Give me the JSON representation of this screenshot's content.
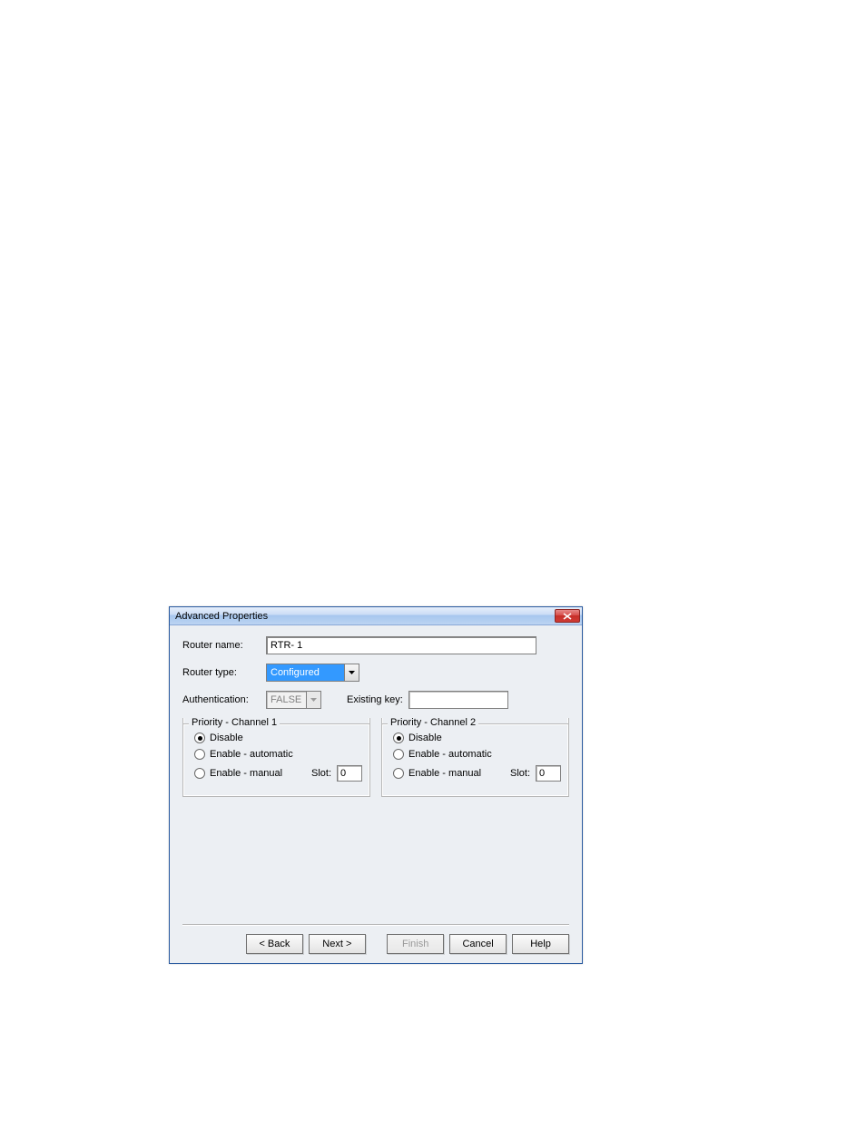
{
  "dialog": {
    "title": "Advanced Properties"
  },
  "fields": {
    "router_name_label": "Router name:",
    "router_name_value": "RTR- 1",
    "router_type_label": "Router type:",
    "router_type_value": "Configured",
    "authentication_label": "Authentication:",
    "authentication_value": "FALSE",
    "existing_key_label": "Existing key:",
    "existing_key_value": ""
  },
  "priority_channel_1": {
    "legend": "Priority - Channel 1",
    "options": {
      "disable": "Disable",
      "enable_auto": "Enable - automatic",
      "enable_manual": "Enable - manual"
    },
    "selected": "disable",
    "slot_label": "Slot:",
    "slot_value": "0"
  },
  "priority_channel_2": {
    "legend": "Priority - Channel 2",
    "options": {
      "disable": "Disable",
      "enable_auto": "Enable - automatic",
      "enable_manual": "Enable - manual"
    },
    "selected": "disable",
    "slot_label": "Slot:",
    "slot_value": "0"
  },
  "buttons": {
    "back": "< Back",
    "next": "Next >",
    "finish": "Finish",
    "cancel": "Cancel",
    "help": "Help"
  }
}
